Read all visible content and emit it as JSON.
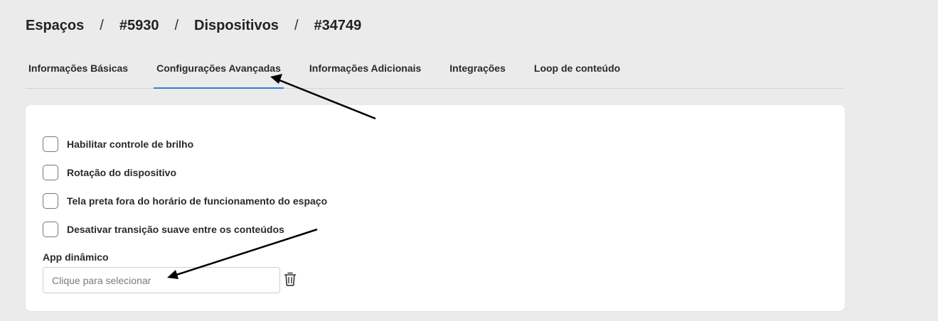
{
  "breadcrumb": {
    "items": [
      "Espaços",
      "#5930",
      "Dispositivos",
      "#34749"
    ],
    "separator": "/"
  },
  "tabs": [
    {
      "label": "Informações Básicas",
      "active": false
    },
    {
      "label": "Configurações Avançadas",
      "active": true
    },
    {
      "label": "Informações Adicionais",
      "active": false
    },
    {
      "label": "Integrações",
      "active": false
    },
    {
      "label": "Loop de conteúdo",
      "active": false
    }
  ],
  "options": [
    {
      "label": "Habilitar controle de brilho",
      "checked": false
    },
    {
      "label": "Rotação do dispositivo",
      "checked": false
    },
    {
      "label": "Tela preta fora do horário de funcionamento do espaço",
      "checked": false
    },
    {
      "label": "Desativar transição suave entre os conteúdos",
      "checked": false
    }
  ],
  "app_dinamico": {
    "label": "App dinâmico",
    "placeholder": "Clique para selecionar"
  },
  "icons": {
    "delete": "trash-icon"
  },
  "colors": {
    "background": "#ebebeb",
    "active_tab_underline": "#2f7de1",
    "card": "#ffffff"
  }
}
